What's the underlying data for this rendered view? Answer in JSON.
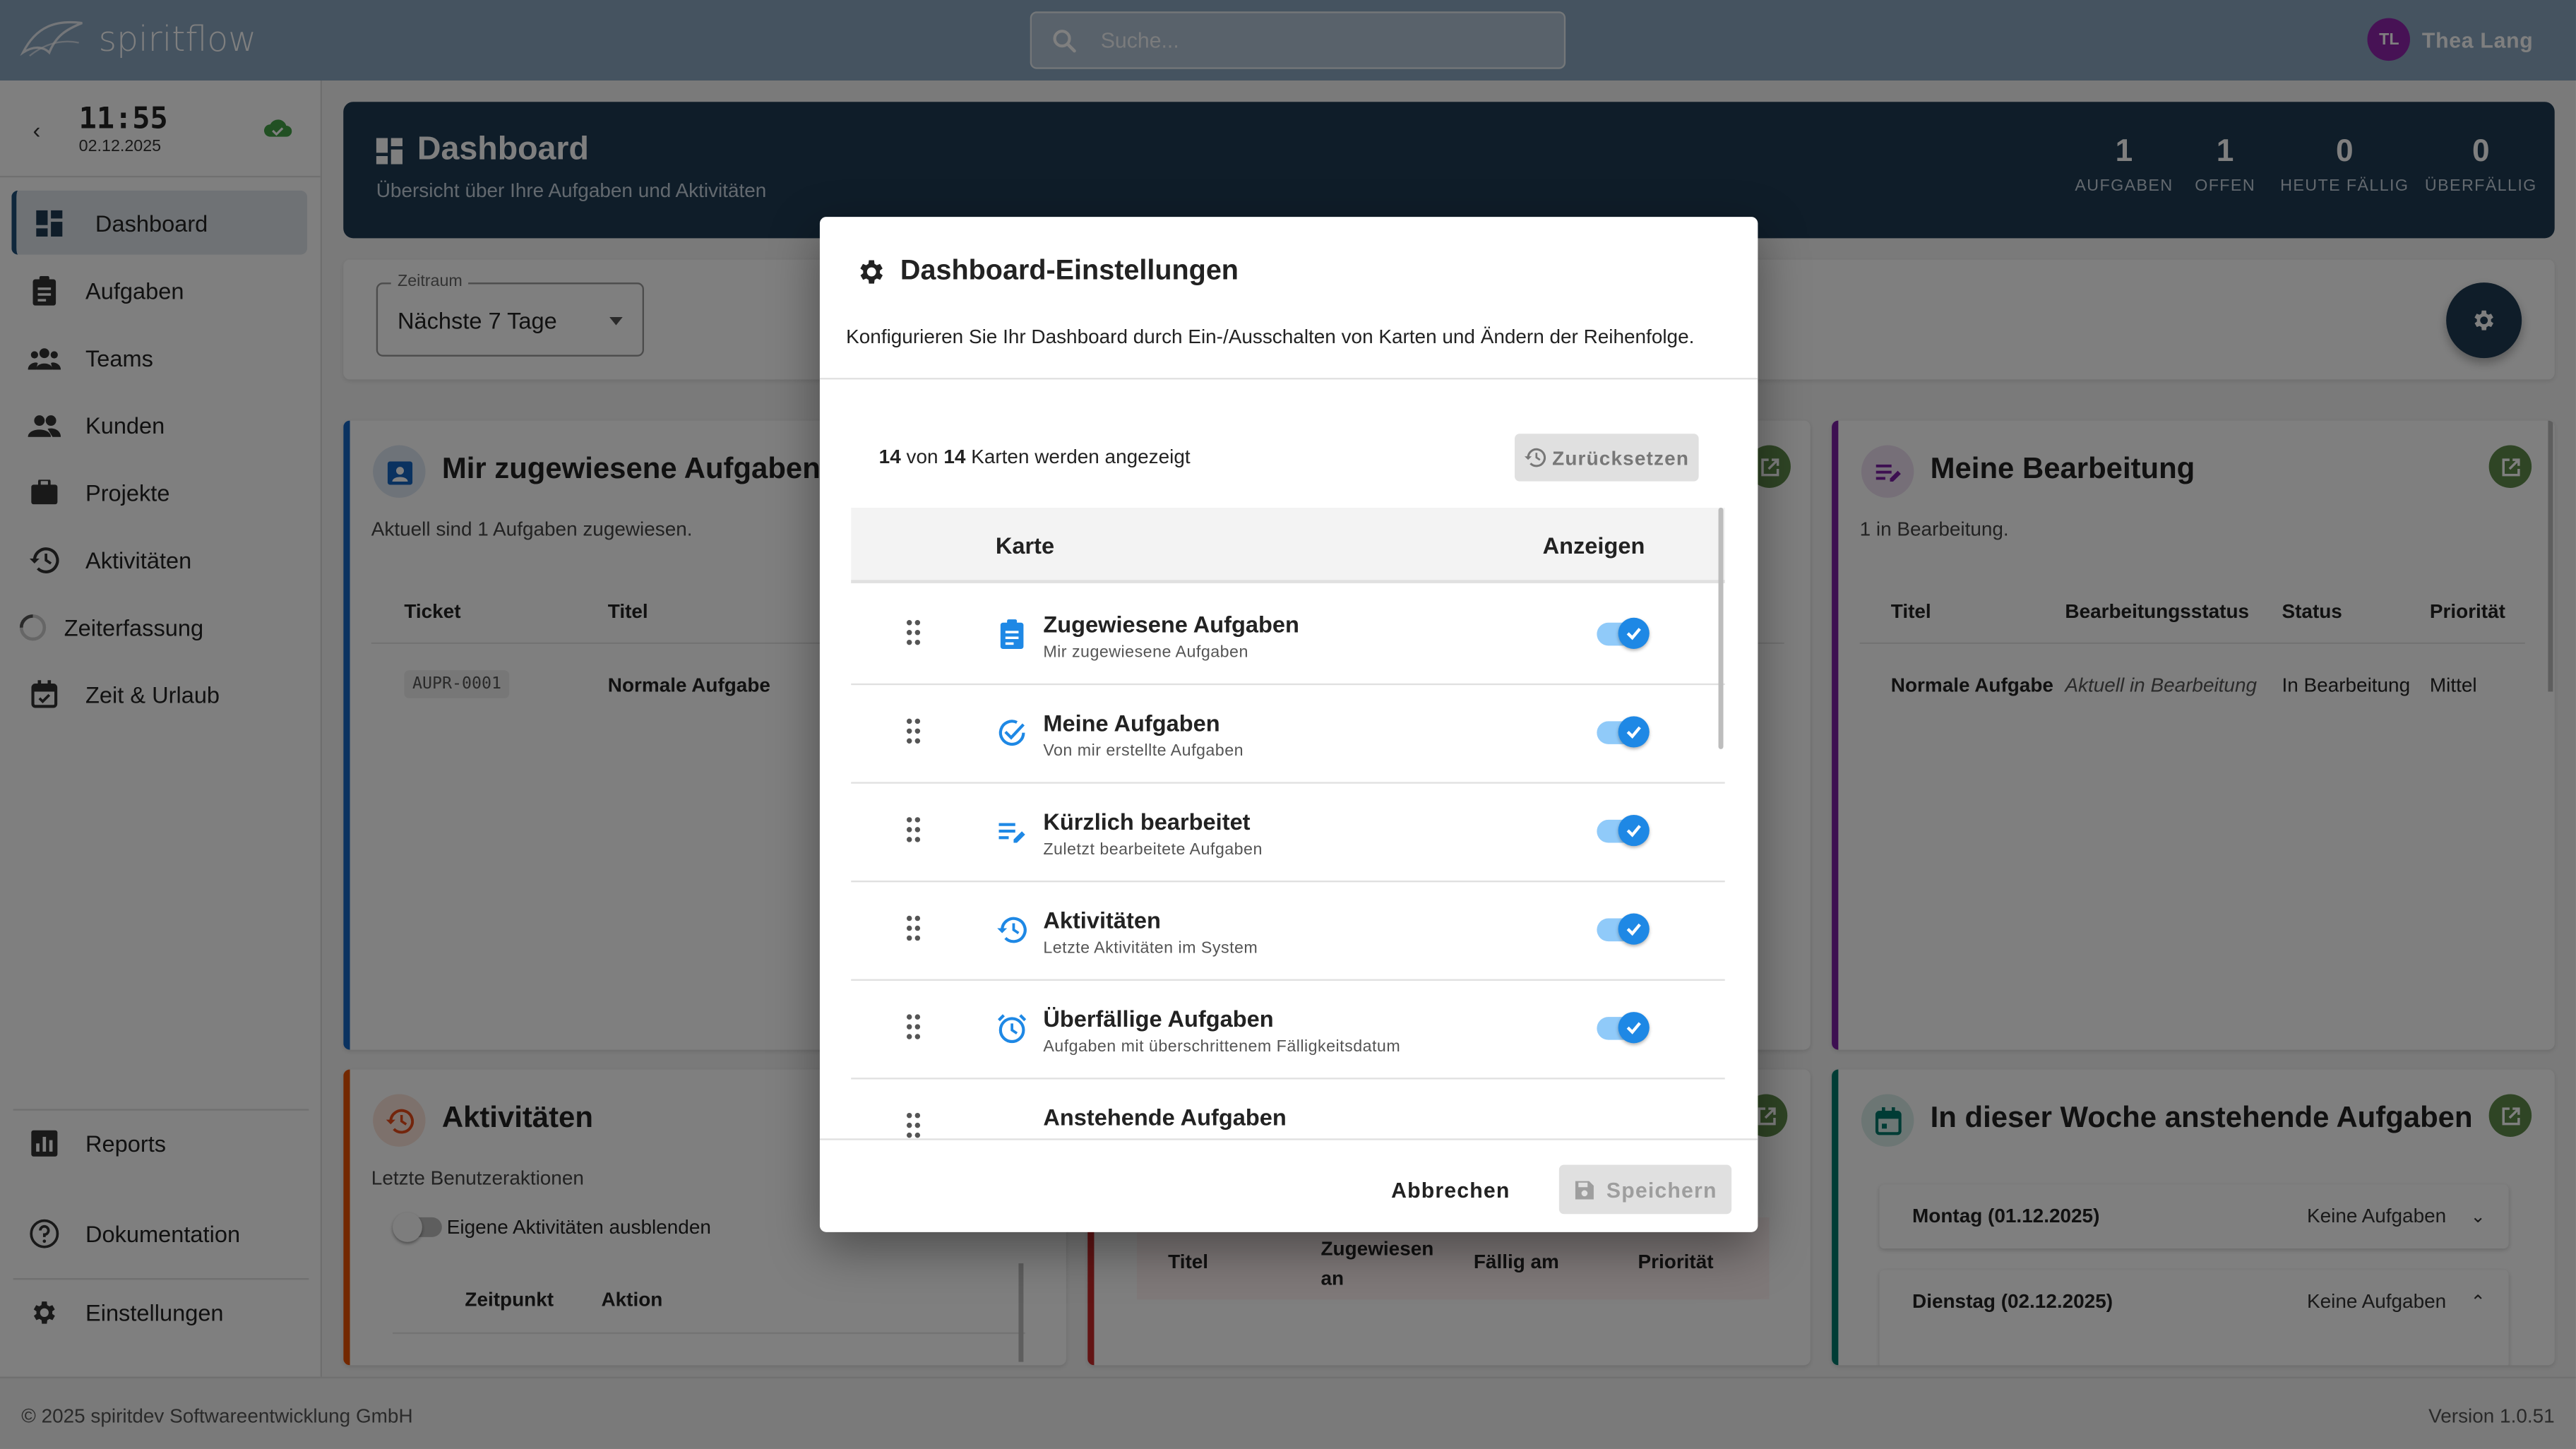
{
  "app": {
    "name": "spiritflow"
  },
  "search": {
    "placeholder": "Suche..."
  },
  "user": {
    "initials": "TL",
    "name": "Thea Lang",
    "avatar_color": "#8e24aa"
  },
  "sidebar": {
    "time": "11:55",
    "date": "02.12.2025",
    "items": [
      {
        "label": "Dashboard",
        "icon": "dashboard-icon",
        "active": true
      },
      {
        "label": "Aufgaben",
        "icon": "clipboard-icon"
      },
      {
        "label": "Teams",
        "icon": "groups-icon"
      },
      {
        "label": "Kunden",
        "icon": "people-icon"
      },
      {
        "label": "Projekte",
        "icon": "briefcase-icon"
      },
      {
        "label": "Aktivitäten",
        "icon": "history-icon"
      },
      {
        "label": "Zeiterfassung",
        "icon": "spinner-icon"
      },
      {
        "label": "Zeit & Urlaub",
        "icon": "calendar-check-icon"
      }
    ],
    "bottom": [
      {
        "label": "Reports",
        "icon": "chart-icon"
      },
      {
        "label": "Dokumentation",
        "icon": "help-icon"
      },
      {
        "label": "Einstellungen",
        "icon": "gear-icon"
      }
    ]
  },
  "header": {
    "title": "Dashboard",
    "subtitle": "Übersicht über Ihre Aufgaben und Aktivitäten",
    "stats": [
      {
        "value": "1",
        "label": "AUFGABEN"
      },
      {
        "value": "1",
        "label": "OFFEN"
      },
      {
        "value": "0",
        "label": "HEUTE FÄLLIG"
      },
      {
        "value": "0",
        "label": "ÜBERFÄLLIG"
      }
    ]
  },
  "filter": {
    "label": "Zeitraum",
    "value": "Nächste 7 Tage"
  },
  "cards": {
    "assigned": {
      "title": "Mir zugewiesene Aufgaben",
      "subtitle": "Aktuell sind 1 Aufgaben zugewiesen.",
      "headers": [
        "Ticket",
        "Titel"
      ],
      "row": [
        "AUPR-0001",
        "Normale Aufgabe"
      ],
      "accent": "#1565c0"
    },
    "editing": {
      "title": "Meine Bearbeitung",
      "subtitle": "1 in Bearbeitung.",
      "headers": [
        "Titel",
        "Bearbeitungsstatus",
        "Status",
        "Priorität"
      ],
      "row": [
        "Normale Aufgabe",
        "Aktuell in Bearbeitung",
        "In Bearbeitung",
        "Mittel"
      ],
      "accent": "#7b1fa2"
    },
    "activities": {
      "title": "Aktivitäten",
      "subtitle": "Letzte Benutzeraktionen",
      "toggle_label": "Eigene Aktivitäten ausblenden",
      "headers": [
        "Zeitpunkt",
        "Aktion"
      ],
      "accent": "#e65100"
    },
    "overdue": {
      "headers": [
        "Titel",
        "Zugewiesen an",
        "Fällig am",
        "Priorität"
      ],
      "accent": "#c62828"
    },
    "week": {
      "title": "In dieser Woche anstehende Aufgaben",
      "accent": "#00796b",
      "days": [
        {
          "label": "Montag (01.12.2025)",
          "status": "Keine Aufgaben",
          "chevron": "down"
        },
        {
          "label": "Dienstag (02.12.2025)",
          "status": "Keine Aufgaben",
          "chevron": "up"
        }
      ]
    }
  },
  "dialog": {
    "title": "Dashboard-Einstellungen",
    "description": "Konfigurieren Sie Ihr Dashboard durch Ein-/Ausschalten von Karten und Ändern der Reihenfolge.",
    "count_shown": "14",
    "count_total": "14",
    "count_text_mid": "von",
    "count_text_end": "Karten werden angezeigt",
    "reset_label": "Zurücksetzen",
    "col_card": "Karte",
    "col_show": "Anzeigen",
    "rows": [
      {
        "title": "Zugewiesene Aufgaben",
        "subtitle": "Mir zugewiesene Aufgaben",
        "icon": "clipboard-icon",
        "enabled": true
      },
      {
        "title": "Meine Aufgaben",
        "subtitle": "Von mir erstellte Aufgaben",
        "icon": "check-circle-icon",
        "enabled": true
      },
      {
        "title": "Kürzlich bearbeitet",
        "subtitle": "Zuletzt bearbeitete Aufgaben",
        "icon": "edit-list-icon",
        "enabled": true
      },
      {
        "title": "Aktivitäten",
        "subtitle": "Letzte Aktivitäten im System",
        "icon": "history-icon",
        "enabled": true
      },
      {
        "title": "Überfällige Aufgaben",
        "subtitle": "Aufgaben mit überschrittenem Fälligkeitsdatum",
        "icon": "alarm-icon",
        "enabled": true
      },
      {
        "title": "Anstehende Aufgaben",
        "subtitle": "",
        "icon": "calendar-icon",
        "enabled": true
      }
    ],
    "cancel_label": "Abbrechen",
    "save_label": "Speichern"
  },
  "footer": {
    "copyright": "© 2025 spiritdev Softwareentwicklung GmbH",
    "version": "Version 1.0.51"
  },
  "colors": {
    "topbar": "#8aa6c1",
    "header": "#1e3a52",
    "primary": "#1e88e5",
    "success": "#5e8a4a"
  }
}
